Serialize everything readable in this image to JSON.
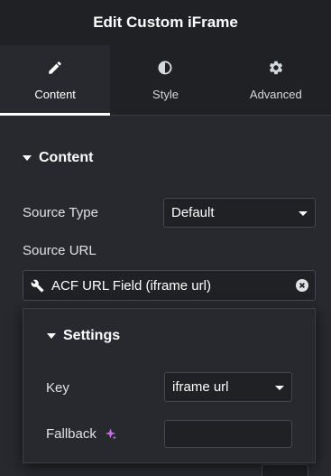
{
  "header": {
    "title": "Edit Custom iFrame"
  },
  "tabs": [
    {
      "label": "Content",
      "icon": "pencil-icon",
      "active": true
    },
    {
      "label": "Style",
      "icon": "half-circle-icon",
      "active": false
    },
    {
      "label": "Advanced",
      "icon": "gear-icon",
      "active": false
    }
  ],
  "section": {
    "title": "Content"
  },
  "source_type": {
    "label": "Source Type",
    "value": "Default"
  },
  "source_url": {
    "label": "Source URL",
    "value": "ACF URL Field (iframe url)",
    "icon": "wrench-icon"
  },
  "settings_popover": {
    "title": "Settings",
    "key": {
      "label": "Key",
      "value": "iframe url"
    },
    "fallback": {
      "label": "Fallback",
      "value": "",
      "icon": "sparkle-icon"
    }
  },
  "colors": {
    "panel_bg": "#27292e",
    "header_bg": "#1f2124",
    "input_bg": "#1f2124",
    "border": "#44474d",
    "accent_ai": "#c26ee6"
  }
}
